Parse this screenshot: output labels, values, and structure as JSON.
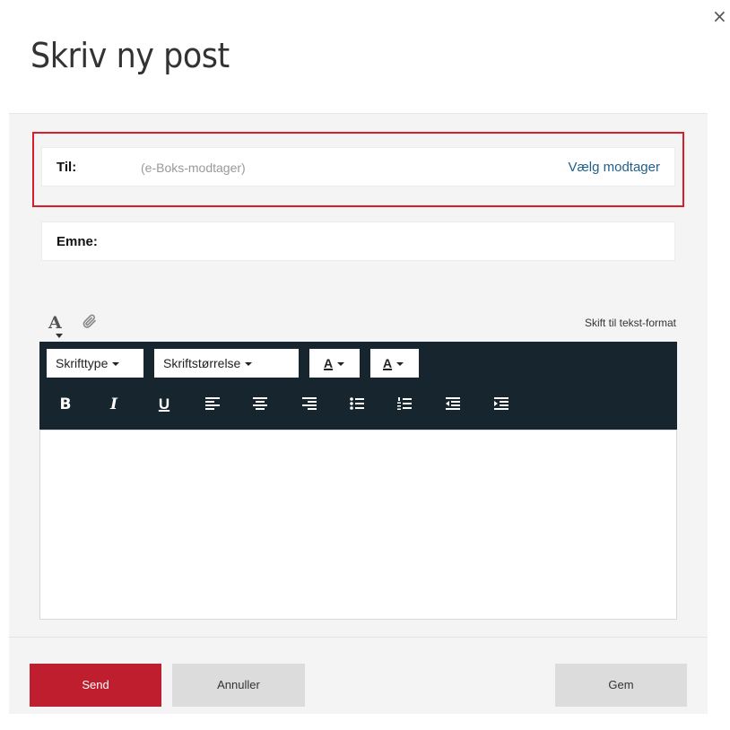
{
  "dialog": {
    "title": "Skriv ny post",
    "close_icon": "×"
  },
  "recipient": {
    "label": "Til:",
    "placeholder": "(e-Boks-modtager)",
    "choose_label": "Vælg modtager"
  },
  "subject": {
    "label": "Emne:",
    "value": ""
  },
  "editor_tabs": {
    "font_icon_glyph": "A",
    "font_icon": "font-format-icon",
    "attach_icon": "paperclip-icon",
    "switch_label": "Skift til tekst-format"
  },
  "toolbar": {
    "font_family": "Skrifttype",
    "font_size": "Skriftstørrelse",
    "text_color": "A",
    "highlight_color": "A",
    "bold": "B",
    "italic": "I",
    "underline": "U"
  },
  "editor": {
    "content": ""
  },
  "actions": {
    "send": "Send",
    "cancel": "Annuller",
    "save": "Gem"
  },
  "colors": {
    "accent": "#be1e2d",
    "highlight_border": "#d81e2a",
    "toolbar_bg": "#17262e",
    "link": "#1f5f8b"
  }
}
